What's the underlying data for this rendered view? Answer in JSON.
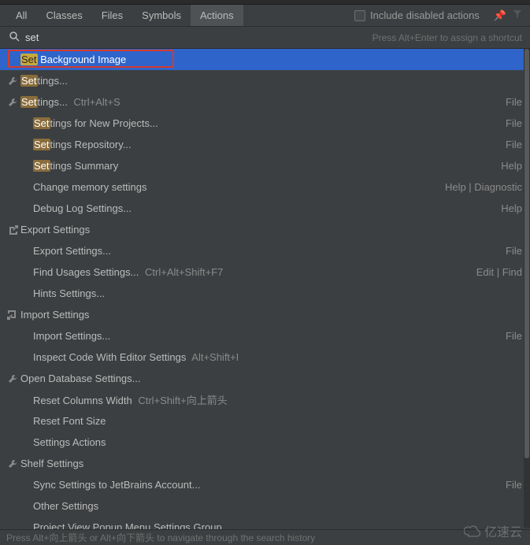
{
  "tabs": {
    "items": [
      "All",
      "Classes",
      "Files",
      "Symbols",
      "Actions"
    ],
    "active_index": 4,
    "include_disabled": "Include disabled actions"
  },
  "search": {
    "query": "set",
    "shortcut_hint": "Press Alt+Enter to assign a shortcut"
  },
  "rows": [
    {
      "icon": "",
      "pre": "Set",
      "post": " Background Image",
      "kbd": "",
      "right": "",
      "sel": true,
      "indent": false
    },
    {
      "icon": "wrench",
      "pre": "Set",
      "post": "tings...",
      "kbd": "",
      "right": "",
      "sel": false,
      "indent": false
    },
    {
      "icon": "wrench",
      "pre": "Set",
      "post": "tings...",
      "kbd": " Ctrl+Alt+S",
      "right": "File",
      "sel": false,
      "indent": false
    },
    {
      "icon": "",
      "pre": "Set",
      "post": "tings for New Projects...",
      "kbd": "",
      "right": "File",
      "sel": false,
      "indent": true
    },
    {
      "icon": "",
      "pre": "Set",
      "post": "tings Repository...",
      "kbd": "",
      "right": "File",
      "sel": false,
      "indent": true
    },
    {
      "icon": "",
      "pre": "Set",
      "post": "tings Summary",
      "kbd": "",
      "right": "Help",
      "sel": false,
      "indent": true
    },
    {
      "icon": "",
      "pre": "",
      "post": "Change memory settings",
      "kbd": "",
      "right": "Help | Diagnostic",
      "sel": false,
      "indent": true
    },
    {
      "icon": "",
      "pre": "",
      "post": "Debug Log Settings...",
      "kbd": "",
      "right": "Help",
      "sel": false,
      "indent": true
    },
    {
      "icon": "export",
      "pre": "",
      "post": "Export Settings",
      "kbd": "",
      "right": "",
      "sel": false,
      "indent": false
    },
    {
      "icon": "",
      "pre": "",
      "post": "Export Settings...",
      "kbd": "",
      "right": "File",
      "sel": false,
      "indent": true
    },
    {
      "icon": "",
      "pre": "",
      "post": "Find Usages Settings...",
      "kbd": " Ctrl+Alt+Shift+F7",
      "right": "Edit | Find",
      "sel": false,
      "indent": true
    },
    {
      "icon": "",
      "pre": "",
      "post": "Hints Settings...",
      "kbd": "",
      "right": "",
      "sel": false,
      "indent": true
    },
    {
      "icon": "import",
      "pre": "",
      "post": "Import Settings",
      "kbd": "",
      "right": "",
      "sel": false,
      "indent": false
    },
    {
      "icon": "",
      "pre": "",
      "post": "Import Settings...",
      "kbd": "",
      "right": "File",
      "sel": false,
      "indent": true
    },
    {
      "icon": "",
      "pre": "",
      "post": "Inspect Code With Editor Settings",
      "kbd": " Alt+Shift+I",
      "right": "",
      "sel": false,
      "indent": true
    },
    {
      "icon": "wrench",
      "pre": "",
      "post": "Open Database Settings...",
      "kbd": "",
      "right": "",
      "sel": false,
      "indent": false
    },
    {
      "icon": "",
      "pre": "",
      "post": "Reset Columns Width",
      "kbd": " Ctrl+Shift+向上箭头",
      "right": "",
      "sel": false,
      "indent": true
    },
    {
      "icon": "",
      "pre": "",
      "post": "Reset Font Size",
      "kbd": "",
      "right": "",
      "sel": false,
      "indent": true
    },
    {
      "icon": "",
      "pre": "",
      "post": "Settings Actions",
      "kbd": "",
      "right": "",
      "sel": false,
      "indent": true
    },
    {
      "icon": "wrench",
      "pre": "",
      "post": "Shelf Settings",
      "kbd": "",
      "right": "",
      "sel": false,
      "indent": false
    },
    {
      "icon": "",
      "pre": "",
      "post": "Sync Settings to JetBrains Account...",
      "kbd": "",
      "right": "File",
      "sel": false,
      "indent": true
    },
    {
      "icon": "",
      "pre": "",
      "post": "Other Settings",
      "kbd": "",
      "right": "",
      "sel": false,
      "indent": true
    },
    {
      "icon": "",
      "pre": "",
      "post": "Project View Popup Menu Settings Group",
      "kbd": "",
      "right": "",
      "sel": false,
      "indent": true
    }
  ],
  "footer": "Press Alt+向上箭头 or Alt+向下箭头 to navigate through the search history",
  "watermark": "亿速云"
}
